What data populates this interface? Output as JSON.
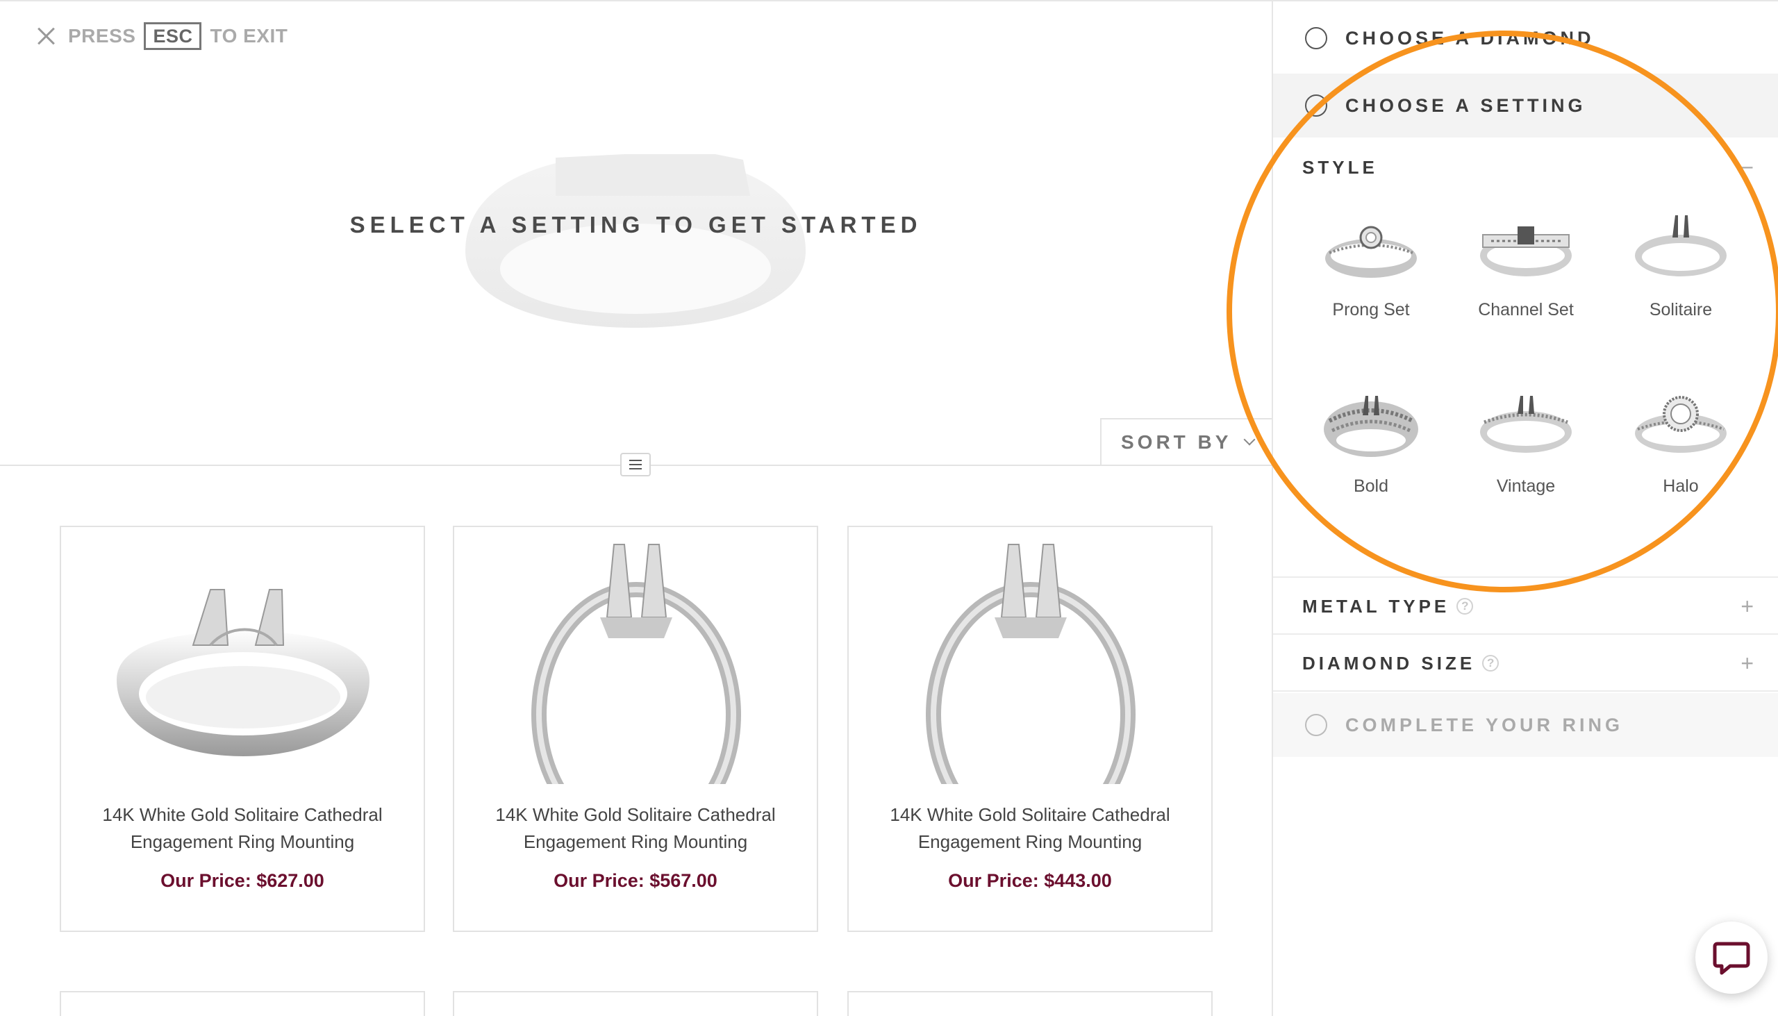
{
  "exit_hint": {
    "press": "PRESS",
    "key": "ESC",
    "to_exit": "TO EXIT"
  },
  "hero": {
    "title": "SELECT A SETTING TO GET STARTED"
  },
  "sort": {
    "label": "SORT BY"
  },
  "products": [
    {
      "name": "14K White Gold Solitaire Cathedral Engagement Ring Mounting",
      "price": "Our Price: $627.00"
    },
    {
      "name": "14K White Gold Solitaire Cathedral Engagement Ring Mounting",
      "price": "Our Price: $567.00"
    },
    {
      "name": "14K White Gold Solitaire Cathedral Engagement Ring Mounting",
      "price": "Our Price: $443.00"
    }
  ],
  "steps": {
    "diamond": "CHOOSE A DIAMOND",
    "setting": "CHOOSE A SETTING",
    "complete": "COMPLETE YOUR RING"
  },
  "filters": {
    "style": {
      "label": "STYLE",
      "toggle": "−"
    },
    "metal": {
      "label": "METAL TYPE",
      "help": "?",
      "toggle": "+"
    },
    "size": {
      "label": "DIAMOND SIZE",
      "help": "?",
      "toggle": "+"
    }
  },
  "styles": [
    "Prong Set",
    "Channel Set",
    "Solitaire",
    "Bold",
    "Vintage",
    "Halo"
  ],
  "colors": {
    "accent_highlight": "#f7931e",
    "price": "#6b0f2e",
    "chat": "#6b0f2e"
  },
  "icons": {
    "close": "close-icon",
    "chat": "chat-icon",
    "menu": "menu-icon"
  }
}
